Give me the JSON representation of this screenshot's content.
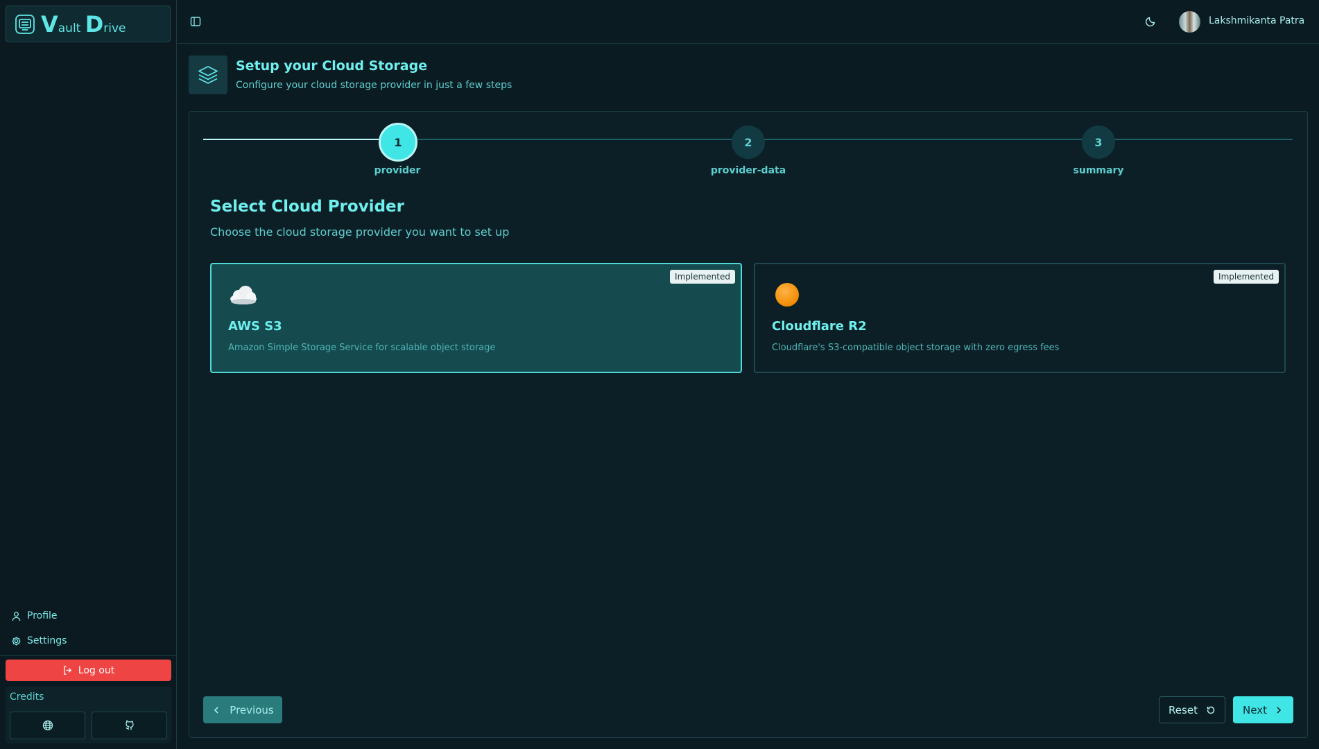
{
  "app": {
    "logo_letter_v": "V",
    "logo_rest_v": "ault",
    "logo_letter_d": "D",
    "logo_rest_d": "rive"
  },
  "sidebar": {
    "profile_label": "Profile",
    "settings_label": "Settings",
    "logout_label": "Log out",
    "credits_title": "Credits"
  },
  "header": {
    "user_name": "Lakshmikanta Patra"
  },
  "page": {
    "title": "Setup your Cloud Storage",
    "subtitle": "Configure your cloud storage provider in just a few steps"
  },
  "steps": [
    {
      "number": "1",
      "label": "provider",
      "active": true
    },
    {
      "number": "2",
      "label": "provider-data",
      "active": false
    },
    {
      "number": "3",
      "label": "summary",
      "active": false
    }
  ],
  "section": {
    "title": "Select Cloud Provider",
    "subtitle": "Choose the cloud storage provider you want to set up"
  },
  "providers": [
    {
      "icon": "cloud-icon",
      "name": "AWS S3",
      "description": "Amazon Simple Storage Service for scalable object storage",
      "badge": "Implemented",
      "selected": true
    },
    {
      "icon": "orange-circle-icon",
      "name": "Cloudflare R2",
      "description": "Cloudflare's S3-compatible object storage with zero egress fees",
      "badge": "Implemented",
      "selected": false
    }
  ],
  "actions": {
    "previous_label": "Previous",
    "reset_label": "Reset",
    "next_label": "Next"
  },
  "colors": {
    "accent": "#40e6e6",
    "background": "#0b1b22",
    "danger": "#ef4444",
    "cloudflare_orange": "#f7931e"
  }
}
